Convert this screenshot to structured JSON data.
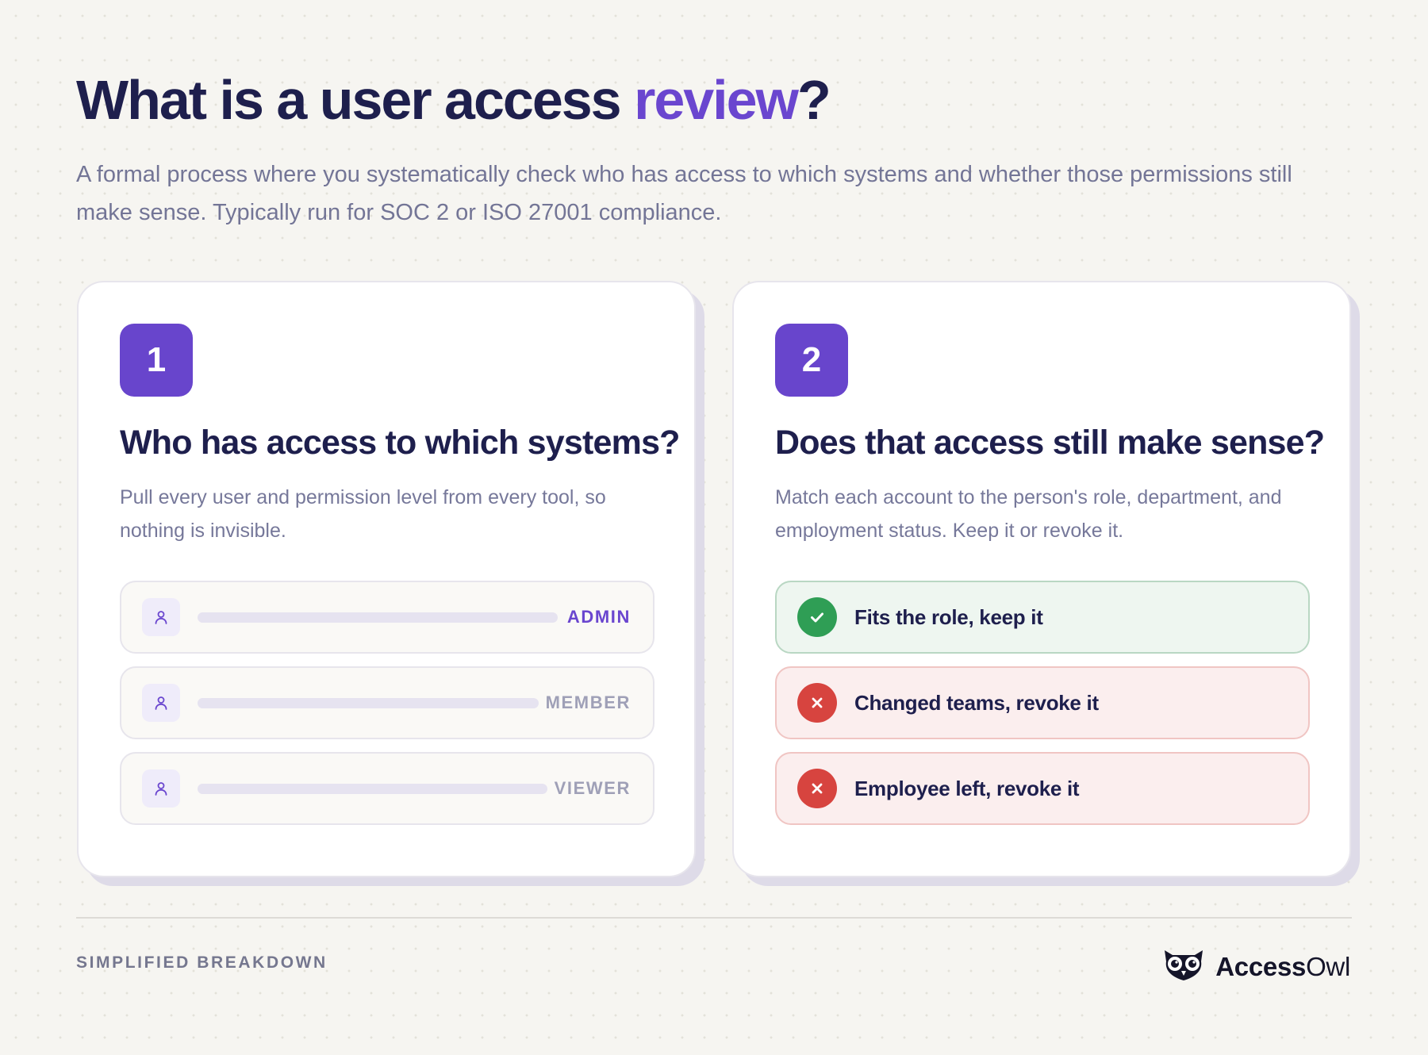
{
  "header": {
    "title_main": "What is a user access ",
    "title_accent": "review",
    "title_end": "?",
    "subtitle": "A formal process where you systematically check who has access to which systems and whether those permissions still make sense. Typically run for SOC 2 or ISO 27001 compliance."
  },
  "cards": [
    {
      "step": "1",
      "title": "Who has access to which systems?",
      "description": "Pull every user and permission level from every tool, so nothing is invisible.",
      "rows": [
        {
          "role": "ADMIN",
          "icon": "user-icon"
        },
        {
          "role": "MEMBER",
          "icon": "user-icon"
        },
        {
          "role": "VIEWER",
          "icon": "user-icon"
        }
      ]
    },
    {
      "step": "2",
      "title": "Does that access still make sense?",
      "description": "Match each account to the person's role, department, and employment status. Keep it or revoke it.",
      "rows": [
        {
          "label": "Fits the role, keep it",
          "status": "keep",
          "icon": "check-icon"
        },
        {
          "label": "Changed teams, revoke it",
          "status": "revoke",
          "icon": "x-icon"
        },
        {
          "label": "Employee left, revoke it",
          "status": "revoke",
          "icon": "x-icon"
        }
      ]
    }
  ],
  "footer": {
    "label": "SIMPLIFIED BREAKDOWN",
    "brand_bold": "Access",
    "brand_light": "Owl",
    "brand_icon": "owl-logo-icon"
  },
  "colors": {
    "accent": "#6a46cf",
    "navy": "#1e1f4d",
    "keep": "#2f9e55",
    "revoke": "#d7443f",
    "background": "#f6f5f1"
  }
}
